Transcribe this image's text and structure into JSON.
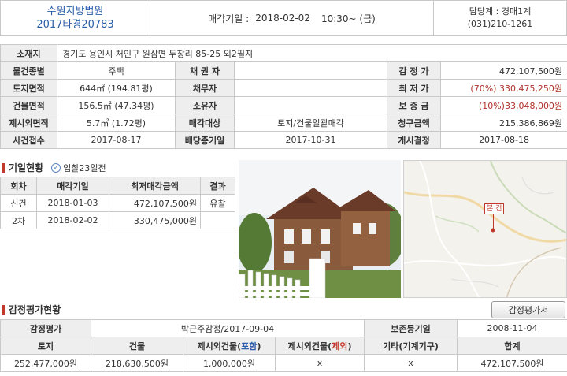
{
  "header": {
    "court": "수원지방법원",
    "case_no": "2017타경20783",
    "sale_date_label": "매각기일 :",
    "sale_date": "2018-02-02",
    "sale_time": "10:30~ (금)",
    "dept": "담당계 : 경매1계",
    "phone": "(031)210-1261"
  },
  "info": {
    "address_label": "소재지",
    "address": "경기도 용인시 처인구 원삼면 두창리 85-25 외2필지",
    "type_label": "물건종별",
    "type": "주택",
    "creditor_label": "채 권 자",
    "creditor": "",
    "appraisal_label": "감 정 가",
    "appraisal": "472,107,500원",
    "land_area_label": "토지면적",
    "land_area": "644㎡ (194.81평)",
    "debtor_label": "채무자",
    "debtor": "",
    "min_price_label": "최 저 가",
    "min_price": "(70%) 330,475,250원",
    "bldg_area_label": "건물면적",
    "bldg_area": "156.5㎡ (47.34평)",
    "owner_label": "소유자",
    "owner": "",
    "deposit_label": "보 증 금",
    "deposit": "(10%)33,048,000원",
    "excl_area_label": "제시외면적",
    "excl_area": "5.7㎡ (1.72평)",
    "sale_target_label": "매각대상",
    "sale_target": "토지/건물일괄매각",
    "claim_label": "청구금액",
    "claim": "215,386,869원",
    "receipt_label": "사건접수",
    "receipt": "2017-08-17",
    "div_deadline_label": "배당종기일",
    "div_deadline": "2017-10-31",
    "start_label": "개시결정",
    "start": "2017-08-18"
  },
  "history": {
    "title": "기일현황",
    "badge": "입찰23일전",
    "columns": [
      "회차",
      "매각기일",
      "최저매각금액",
      "결과"
    ],
    "rows": [
      {
        "round": "신건",
        "date": "2018-01-03",
        "price": "472,107,500원",
        "result": "유찰"
      },
      {
        "round": "2차",
        "date": "2018-02-02",
        "price": "330,475,000원",
        "result": ""
      }
    ]
  },
  "map": {
    "label": "본 건"
  },
  "appraisal": {
    "title": "감정평가현황",
    "button": "감정평가서",
    "r1_label": "감정평가",
    "r1_value": "박근주감정/2017-09-04",
    "r1_date_label": "보존등기일",
    "r1_date": "2008-11-04",
    "columns": {
      "land": "토지",
      "bldg": "건물",
      "excl_incl_pre": "제시외건물(",
      "excl_incl_hl": "포함",
      "excl_excl_pre": "제시외건물(",
      "excl_excl_hl": "제외",
      "close": ")",
      "etc": "기타(기계기구)",
      "total": "합계"
    },
    "values": {
      "land": "252,477,000원",
      "bldg": "218,630,500원",
      "excl_incl": "1,000,000원",
      "excl_excl": "x",
      "etc": "x",
      "total": "472,107,500원"
    }
  }
}
